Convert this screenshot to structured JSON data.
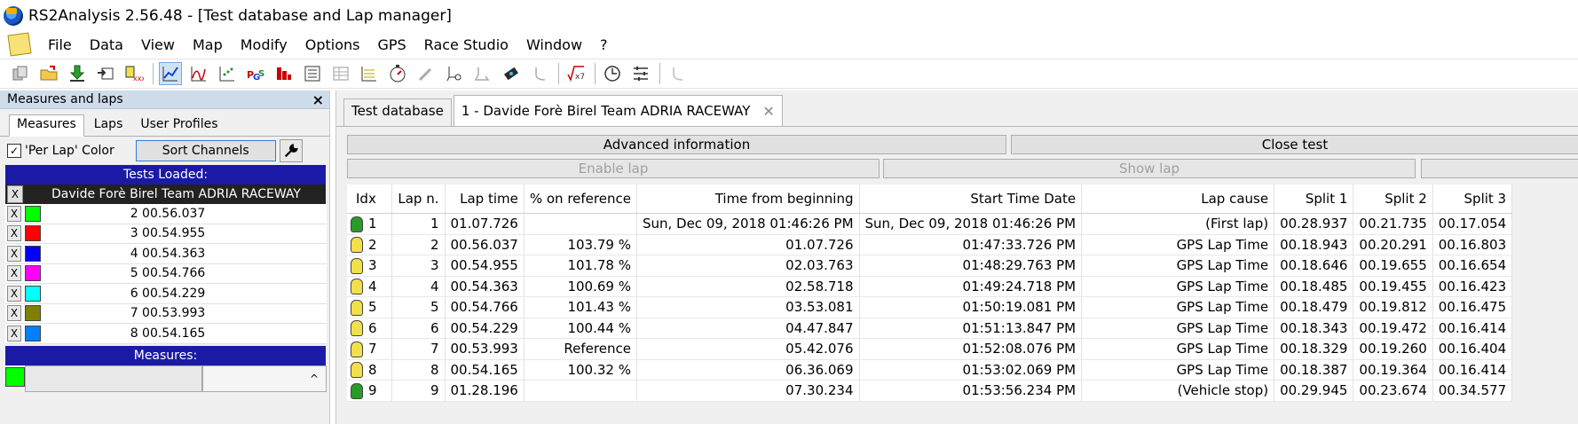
{
  "window": {
    "title": "RS2Analysis 2.56.48 - [Test database and Lap manager]"
  },
  "menu": [
    "File",
    "Data",
    "View",
    "Map",
    "Modify",
    "Options",
    "GPS",
    "Race Studio",
    "Window",
    "?"
  ],
  "left_panel": {
    "header": "Measures and laps",
    "close": "×",
    "tabs": [
      "Measures",
      "Laps",
      "User Profiles"
    ],
    "per_lap_label": "'Per Lap' Color",
    "per_lap_checked": "✓",
    "sort_channels": "Sort Channels",
    "tests_loaded_header": "Tests Loaded:",
    "test_name": "Davide Forè Birel Team ADRIA RACEWAY",
    "x_label": "X",
    "laps": [
      {
        "label": "2 00.56.037",
        "color": "#00ff00"
      },
      {
        "label": "3 00.54.955",
        "color": "#ff0000"
      },
      {
        "label": "4 00.54.363",
        "color": "#0000ff"
      },
      {
        "label": "5 00.54.766",
        "color": "#ff00ff"
      },
      {
        "label": "6 00.54.229",
        "color": "#00ffff"
      },
      {
        "label": "7 00.53.993",
        "color": "#808000"
      },
      {
        "label": "8 00.54.165",
        "color": "#0080ff"
      }
    ],
    "measures_header": "Measures:",
    "scroll_up": "^"
  },
  "tabs": {
    "database": "Test database",
    "test": "1 - Davide Forè Birel Team ADRIA RACEWAY",
    "close": "✕"
  },
  "buttons": {
    "advanced": "Advanced information",
    "close_test": "Close test",
    "enable_lap": "Enable lap",
    "show_lap": "Show lap"
  },
  "table": {
    "columns": [
      "Idx",
      "Lap n.",
      "Lap time",
      "% on reference",
      "Time from beginning",
      "Start Time Date",
      "Lap cause",
      "Split 1",
      "Split 2",
      "Split 3"
    ],
    "rows": [
      {
        "idx": "1",
        "flag": "green",
        "lap": "1",
        "time": "01.07.726",
        "pct": "",
        "from": "Sun, Dec 09, 2018  01:46:26 PM",
        "start": "Sun, Dec 09, 2018  01:46:26 PM",
        "cause": "(First lap)",
        "s1": "00.28.937",
        "s2": "00.21.735",
        "s3": "00.17.054"
      },
      {
        "idx": "2",
        "flag": "yellow",
        "lap": "2",
        "time": "00.56.037",
        "pct": "103.79 %",
        "from": "01.07.726",
        "start": "01:47:33.726 PM",
        "cause": "GPS Lap Time",
        "s1": "00.18.943",
        "s2": "00.20.291",
        "s3": "00.16.803"
      },
      {
        "idx": "3",
        "flag": "yellow",
        "lap": "3",
        "time": "00.54.955",
        "pct": "101.78 %",
        "from": "02.03.763",
        "start": "01:48:29.763 PM",
        "cause": "GPS Lap Time",
        "s1": "00.18.646",
        "s2": "00.19.655",
        "s3": "00.16.654"
      },
      {
        "idx": "4",
        "flag": "yellow",
        "lap": "4",
        "time": "00.54.363",
        "pct": "100.69 %",
        "from": "02.58.718",
        "start": "01:49:24.718 PM",
        "cause": "GPS Lap Time",
        "s1": "00.18.485",
        "s2": "00.19.455",
        "s3": "00.16.423"
      },
      {
        "idx": "5",
        "flag": "yellow",
        "lap": "5",
        "time": "00.54.766",
        "pct": "101.43 %",
        "from": "03.53.081",
        "start": "01:50:19.081 PM",
        "cause": "GPS Lap Time",
        "s1": "00.18.479",
        "s2": "00.19.812",
        "s3": "00.16.475"
      },
      {
        "idx": "6",
        "flag": "yellow",
        "lap": "6",
        "time": "00.54.229",
        "pct": "100.44 %",
        "from": "04.47.847",
        "start": "01:51:13.847 PM",
        "cause": "GPS Lap Time",
        "s1": "00.18.343",
        "s2": "00.19.472",
        "s3": "00.16.414"
      },
      {
        "idx": "7",
        "flag": "yellow",
        "lap": "7",
        "time": "00.53.993",
        "pct": "Reference",
        "from": "05.42.076",
        "start": "01:52:08.076 PM",
        "cause": "GPS Lap Time",
        "s1": "00.18.329",
        "s2": "00.19.260",
        "s3": "00.16.404"
      },
      {
        "idx": "8",
        "flag": "yellow",
        "lap": "8",
        "time": "00.54.165",
        "pct": "100.32 %",
        "from": "06.36.069",
        "start": "01:53:02.069 PM",
        "cause": "GPS Lap Time",
        "s1": "00.18.387",
        "s2": "00.19.364",
        "s3": "00.16.414"
      },
      {
        "idx": "9",
        "flag": "green",
        "lap": "9",
        "time": "01.28.196",
        "pct": "",
        "from": "07.30.234",
        "start": "01:53:56.234 PM",
        "cause": "(Vehicle stop)",
        "s1": "00.29.945",
        "s2": "00.23.674",
        "s3": "00.34.577"
      }
    ]
  }
}
